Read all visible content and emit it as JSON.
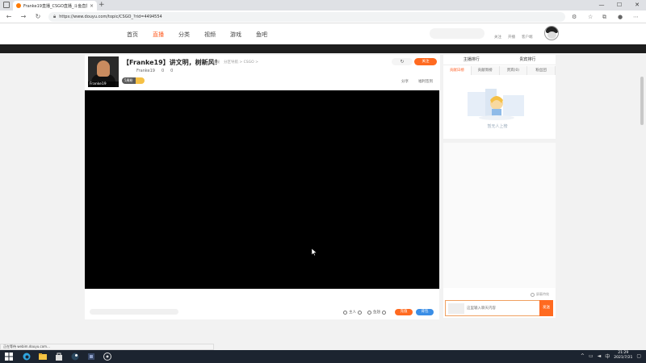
{
  "browser": {
    "tab_title": "Franke19直播_CSGO直播_斗鱼直播",
    "tab_close": "×",
    "new_tab": "+",
    "url": "https://www.douyu.com/topic/CSGO_?rid=4494554",
    "min": "—",
    "max": "☐",
    "close": "✕"
  },
  "site": {
    "nav": [
      {
        "label": "首页"
      },
      {
        "label": "直播"
      },
      {
        "label": "分类"
      },
      {
        "label": "视频"
      },
      {
        "label": "游戏"
      },
      {
        "label": "鱼吧"
      }
    ],
    "header_links": [
      {
        "label": "关注"
      },
      {
        "label": "开播"
      },
      {
        "label": "客户端"
      }
    ]
  },
  "room": {
    "anchor_tag": "Franke19",
    "title": "【Franke19】讲文明，树新风！",
    "meta": [
      "举报",
      "分区导航 > CSGO >"
    ],
    "anchor_name": "Franke19",
    "stat1": "0",
    "stat2": "0",
    "level_badge": "5周粉",
    "loader": "↻",
    "follow_label": "关注",
    "actions": [
      "分享",
      "福利签到"
    ]
  },
  "below": {
    "gift1": "主人",
    "gift2": "鱼翅",
    "orange_btn": "充值",
    "blue_btn": "背包"
  },
  "panel": {
    "tabs1": [
      "主播排行",
      "贵宾排行"
    ],
    "tabs2": [
      "贡献日榜",
      "贡献周榜",
      "贵宾(0)",
      "粉丝团"
    ],
    "empty_text": "暂无人上榜",
    "checkbox_label": "屏蔽特效",
    "chat_placeholder": "这里输入聊天内容",
    "send_label": "发送"
  },
  "status": {
    "text": "正在等待 webim.douyu.com..."
  },
  "taskbar": {
    "time": "21:29",
    "date": "2021/7/21"
  },
  "colors": {
    "accent": "#ff6a20",
    "blue": "#3a8ee6",
    "dark": "#1e1e1e"
  }
}
